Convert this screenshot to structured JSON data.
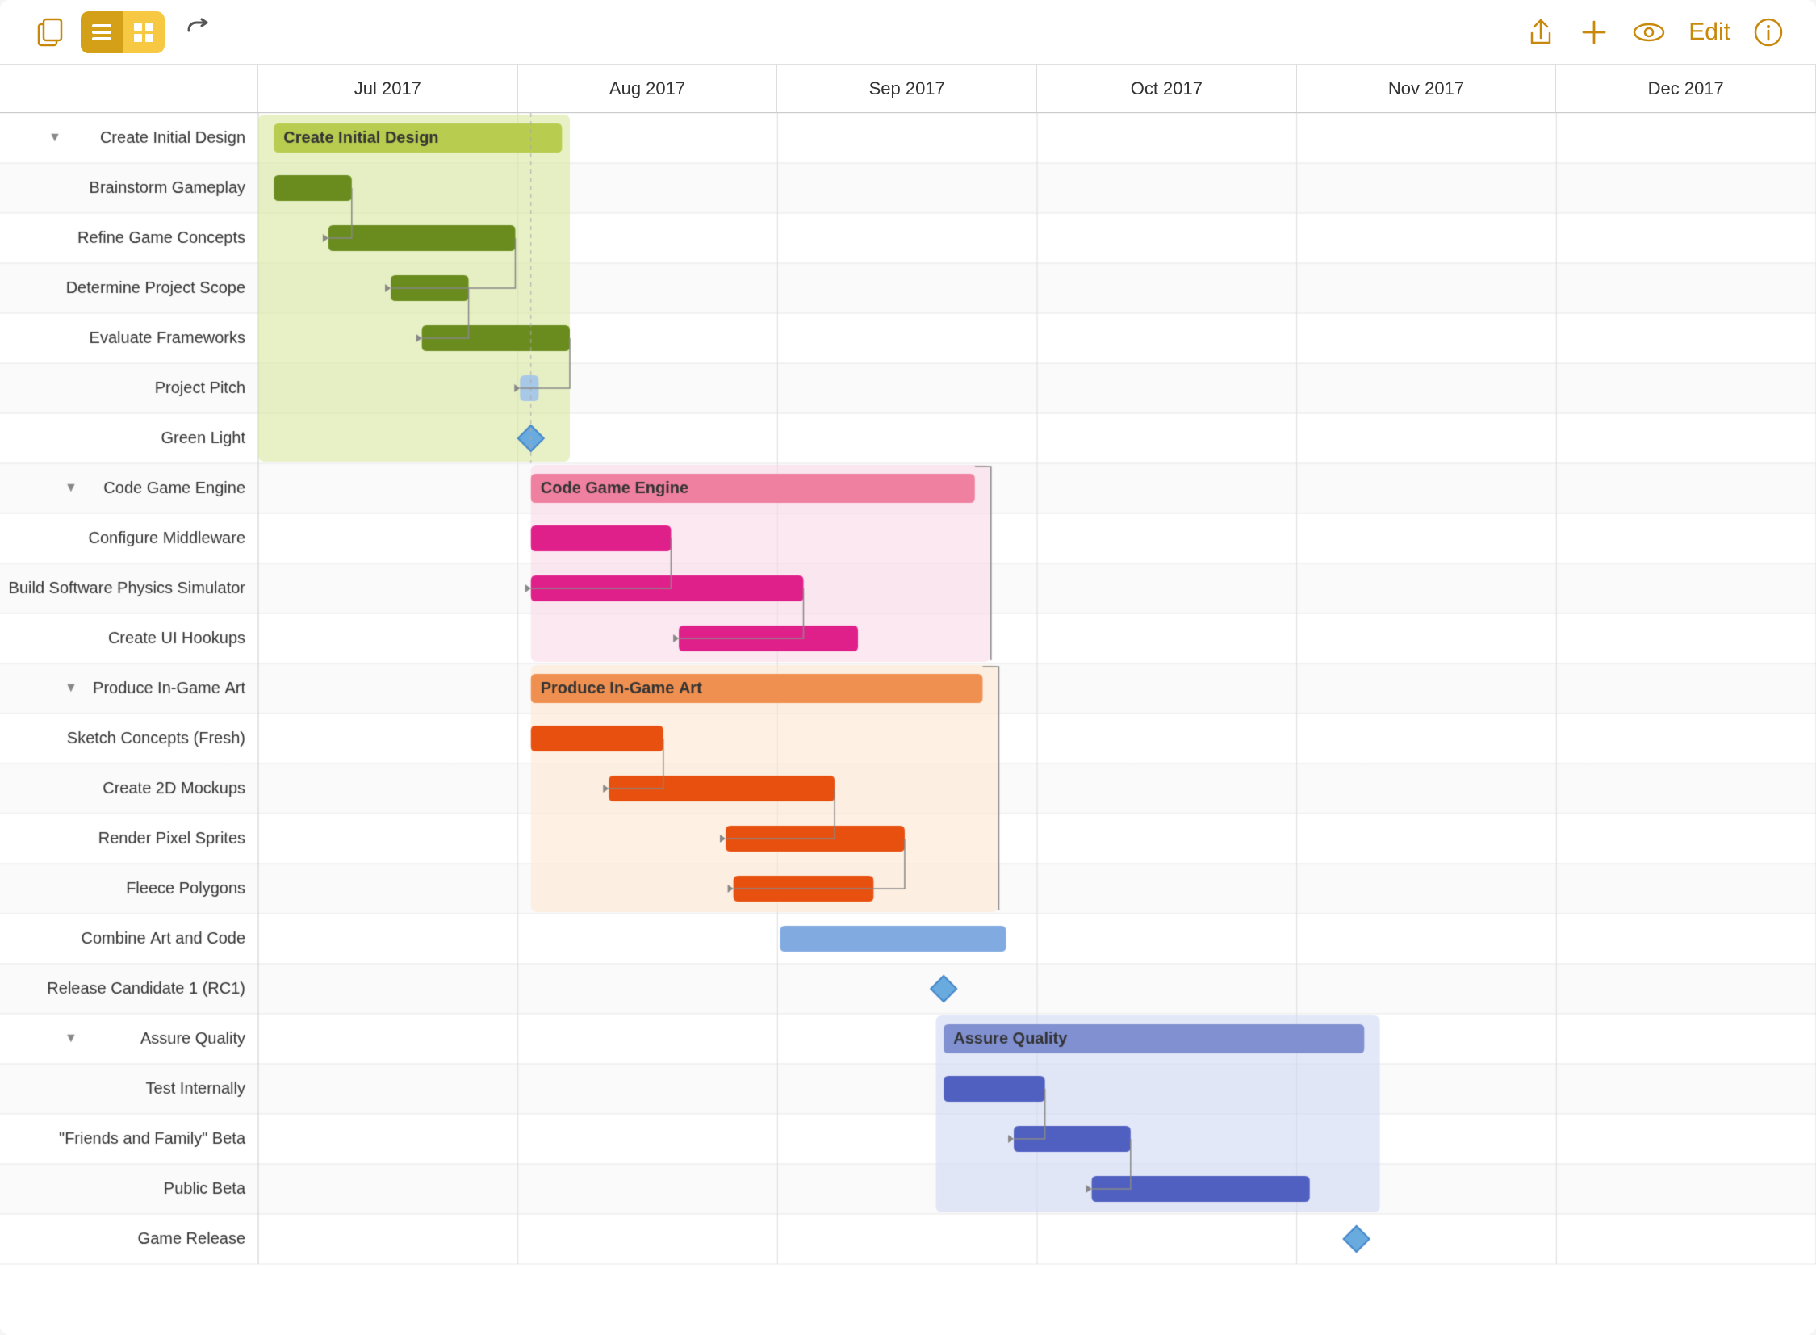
{
  "toolbar": {
    "undo_icon": "↩",
    "edit_label": "Edit",
    "months": [
      "Jul 2017",
      "Aug 2017",
      "Sep 2017",
      "Oct 2017",
      "Nov 2017",
      "Dec 2017"
    ]
  },
  "tasks": [
    {
      "id": 1,
      "label": "Create Initial Design",
      "type": "group",
      "indent": 1,
      "color": "#c8d96a",
      "bar_color": "#b8cc50",
      "start_pct": 0.01,
      "width_pct": 0.185
    },
    {
      "id": 2,
      "label": "Brainstorm Gameplay",
      "type": "task",
      "indent": 2,
      "bar_color": "#6a8c1e",
      "start_pct": 0.01,
      "width_pct": 0.05
    },
    {
      "id": 3,
      "label": "Refine Game Concepts",
      "type": "task",
      "indent": 2,
      "bar_color": "#6a8c1e",
      "start_pct": 0.045,
      "width_pct": 0.12
    },
    {
      "id": 4,
      "label": "Determine Project Scope",
      "type": "task",
      "indent": 1,
      "bar_color": "#6a8c1e",
      "start_pct": 0.085,
      "width_pct": 0.05
    },
    {
      "id": 5,
      "label": "Evaluate Frameworks",
      "type": "task",
      "indent": 1,
      "bar_color": "#6a8c1e",
      "start_pct": 0.105,
      "width_pct": 0.095
    },
    {
      "id": 6,
      "label": "Project Pitch",
      "type": "task",
      "indent": 1,
      "bar_color": "#a8c8e8",
      "start_pct": 0.168,
      "width_pct": 0.012
    },
    {
      "id": 7,
      "label": "Green Light",
      "type": "milestone",
      "indent": 1,
      "bar_color": "#6aabdf",
      "start_pct": 0.175,
      "width_pct": 0
    },
    {
      "id": 8,
      "label": "Code Game Engine",
      "type": "group",
      "indent": 2,
      "color": "#f8c0d8",
      "bar_color": "#f080a0",
      "start_pct": 0.175,
      "width_pct": 0.285
    },
    {
      "id": 9,
      "label": "Configure Middleware",
      "type": "task",
      "indent": 2,
      "bar_color": "#e0208a",
      "start_pct": 0.175,
      "width_pct": 0.09
    },
    {
      "id": 10,
      "label": "Build Software Physics Simulator",
      "type": "task",
      "indent": 1,
      "bar_color": "#e0208a",
      "start_pct": 0.175,
      "width_pct": 0.175
    },
    {
      "id": 11,
      "label": "Create UI Hookups",
      "type": "task",
      "indent": 2,
      "bar_color": "#e0208a",
      "start_pct": 0.27,
      "width_pct": 0.115
    },
    {
      "id": 12,
      "label": "Produce In-Game Art",
      "type": "group",
      "indent": 2,
      "color": "#fde0c0",
      "bar_color": "#f09050",
      "start_pct": 0.175,
      "width_pct": 0.29
    },
    {
      "id": 13,
      "label": "Sketch Concepts (Fresh)",
      "type": "task",
      "indent": 2,
      "bar_color": "#e85010",
      "start_pct": 0.175,
      "width_pct": 0.085
    },
    {
      "id": 14,
      "label": "Create 2D Mockups",
      "type": "task",
      "indent": 2,
      "bar_color": "#e85010",
      "start_pct": 0.225,
      "width_pct": 0.145
    },
    {
      "id": 15,
      "label": "Render Pixel Sprites",
      "type": "task",
      "indent": 3,
      "bar_color": "#e85010",
      "start_pct": 0.3,
      "width_pct": 0.115
    },
    {
      "id": 16,
      "label": "Fleece Polygons",
      "type": "task",
      "indent": 3,
      "bar_color": "#e85010",
      "start_pct": 0.305,
      "width_pct": 0.09
    },
    {
      "id": 17,
      "label": "Combine Art and Code",
      "type": "task",
      "indent": 1,
      "bar_color": "#80aae0",
      "start_pct": 0.335,
      "width_pct": 0.145
    },
    {
      "id": 18,
      "label": "Release Candidate 1 (RC1)",
      "type": "milestone",
      "indent": 1,
      "bar_color": "#6aabdf",
      "start_pct": 0.44,
      "width_pct": 0
    },
    {
      "id": 19,
      "label": "Assure Quality",
      "type": "group",
      "indent": 2,
      "color": "#c0c8f0",
      "bar_color": "#8090d0",
      "start_pct": 0.44,
      "width_pct": 0.27
    },
    {
      "id": 20,
      "label": "Test Internally",
      "type": "task",
      "indent": 2,
      "bar_color": "#5060c0",
      "start_pct": 0.44,
      "width_pct": 0.065
    },
    {
      "id": 21,
      "label": "\"Friends and Family\" Beta",
      "type": "task",
      "indent": 2,
      "bar_color": "#5060c0",
      "start_pct": 0.485,
      "width_pct": 0.075
    },
    {
      "id": 22,
      "label": "Public Beta",
      "type": "task",
      "indent": 2,
      "bar_color": "#5060c0",
      "start_pct": 0.535,
      "width_pct": 0.14
    },
    {
      "id": 23,
      "label": "Game Release",
      "type": "milestone",
      "indent": 1,
      "bar_color": "#6aabdf",
      "start_pct": 0.705,
      "width_pct": 0
    }
  ]
}
